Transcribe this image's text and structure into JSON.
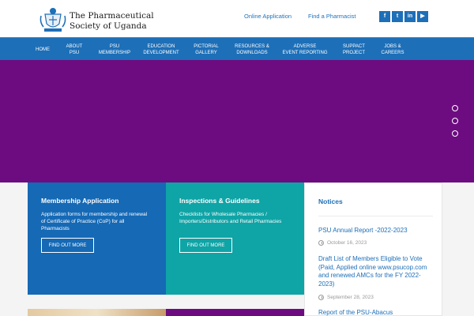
{
  "header": {
    "site_name_line1": "The Pharmaceutical",
    "site_name_line2": "Society of Uganda",
    "links": [
      "Online Application",
      "Find a Pharmacist"
    ],
    "social": [
      {
        "icon": "facebook-icon",
        "glyph": "f"
      },
      {
        "icon": "twitter-icon",
        "glyph": "t"
      },
      {
        "icon": "linkedin-icon",
        "glyph": "in"
      },
      {
        "icon": "youtube-icon",
        "glyph": "▶"
      }
    ]
  },
  "nav": {
    "items": [
      {
        "l1": "HOME",
        "l2": ""
      },
      {
        "l1": "ABOUT",
        "l2": "PSU"
      },
      {
        "l1": "PSU",
        "l2": "MEMBERSHIP"
      },
      {
        "l1": "EDUCATION",
        "l2": "DEVELOPMENT"
      },
      {
        "l1": "PICTORIAL",
        "l2": "GALLERY"
      },
      {
        "l1": "RESOURCES &",
        "l2": "DOWNLOADS"
      },
      {
        "l1": "ADVERSE",
        "l2": "EVENT REPORTING"
      },
      {
        "l1": "SUPPACT",
        "l2": "PROJECT"
      },
      {
        "l1": "JOBS &",
        "l2": "CAREERS"
      }
    ]
  },
  "cards": {
    "membership": {
      "title": "Membership Application",
      "text": "Application forms for membership and renewal of Certificate of Practice (CoP) for all Pharmacists",
      "button": "FIND OUT MORE"
    },
    "inspections": {
      "title": "Inspections & Guidelines",
      "text": "Checklists for Wholesale Pharmacies / Importers/Distributors and Retail Pharmacies",
      "button": "FIND OUT MORE"
    }
  },
  "notices": {
    "title": "Notices",
    "items": [
      {
        "title": "PSU Annual Report -2022-2023",
        "date": "October 16, 2023"
      },
      {
        "title": "Draft List of Members Eligible to Vote (Paid, Applied online www.psucop.com and renewed AMCs for the FY 2022-2023)",
        "date": "September 28, 2023"
      },
      {
        "title": "Report of the PSU-Abacus",
        "date": ""
      }
    ]
  },
  "colors": {
    "primary_blue": "#1d6fb8",
    "hero_purple": "#6d0c80",
    "card_teal": "#0fa4a6"
  }
}
